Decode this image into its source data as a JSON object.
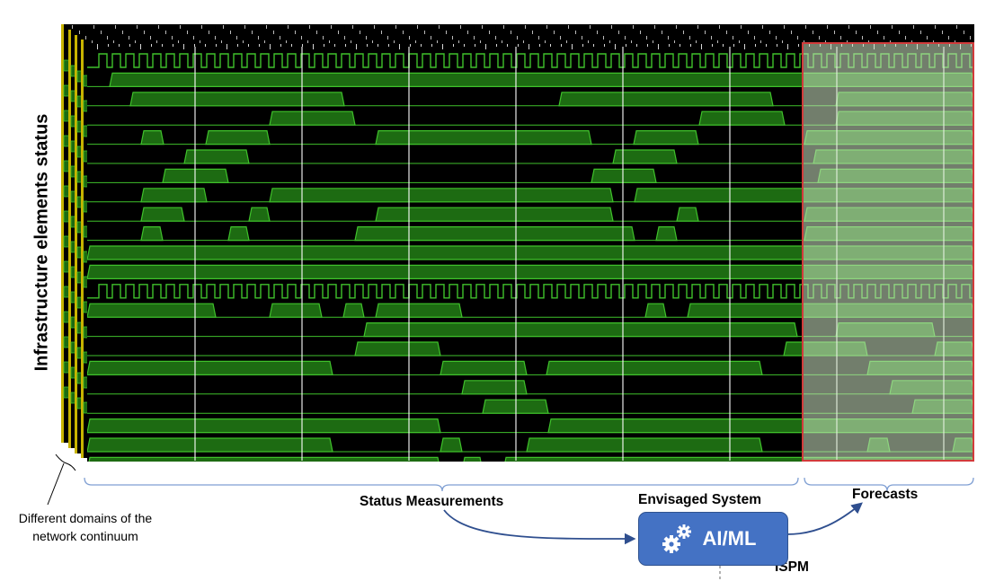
{
  "y_axis_label": "Infrastructure  elements status",
  "labels": {
    "status_measurements": "Status Measurements",
    "envisaged_system": "Envisaged System",
    "forecasts": "Forecasts",
    "ispm": "ISPM",
    "domains_line1": "Different domains of the",
    "domains_line2": "network continuum"
  },
  "ai_box": {
    "label": "AI/ML",
    "icon": "gears-icon"
  },
  "colors": {
    "signal_fill": "#1d6b12",
    "signal_line": "#3fc12b",
    "background": "#000000",
    "forecast_overlay": "#cfe6c5",
    "forecast_border": "#d23b3b",
    "brace": "#7f9fd3",
    "arrow": "#2f4f8f",
    "ai_box": "#4472c4",
    "domain_edge": "#c8b400"
  }
}
